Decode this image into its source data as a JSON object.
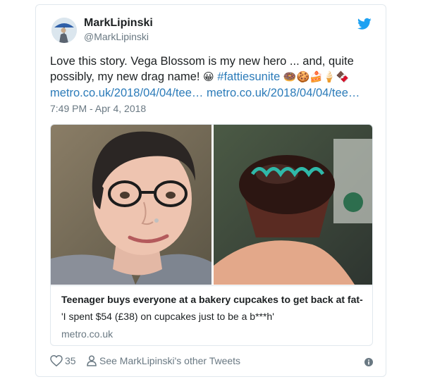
{
  "tweet": {
    "author_name": "MarkLipinski",
    "author_handle": "@MarkLipinski",
    "text_line1": "Love this story. Vega Blossom is my new hero ...  and, quite",
    "text_line2_prefix": "possibly, my new drag name! ",
    "hashtag": "#fattiesunite",
    "emojis": {
      "grin": "😀",
      "donut": "🍩",
      "cookie": "🍪",
      "cake": "🍰",
      "icecream": "🍦",
      "chocolate": "🍫"
    },
    "link1": "metro.co.uk/2018/04/04/tee…",
    "link2": "metro.co.uk/2018/04/04/tee…",
    "timestamp": "7:49 PM - Apr 4, 2018"
  },
  "card": {
    "title": "Teenager buys everyone at a bakery cupcakes to get back at fat-s...",
    "description": "'I spent $54 (£38) on cupcakes just to be a b***h'",
    "domain": "metro.co.uk"
  },
  "footer": {
    "like_count": "35",
    "profile_link": "See MarkLipinski's other Tweets"
  },
  "colors": {
    "link": "#2b7bb9",
    "twitter_blue": "#1da1f2",
    "secondary_text": "#697882"
  },
  "icons": [
    "twitter-bird-icon",
    "heart-icon",
    "person-icon",
    "info-icon"
  ]
}
